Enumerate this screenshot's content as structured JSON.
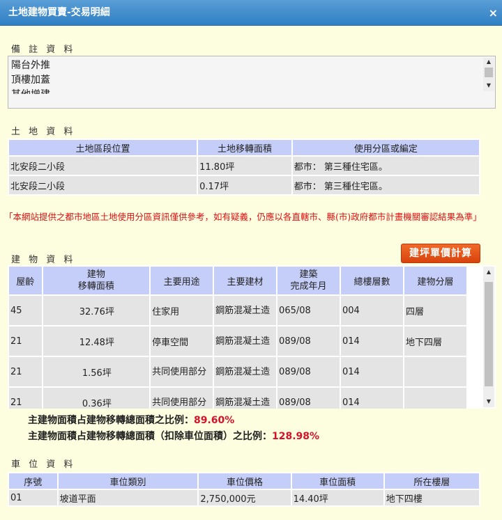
{
  "window": {
    "title": "土地建物買賣-交易明細",
    "close_icon": "×"
  },
  "notes": {
    "title": "備 註 資 料",
    "lines": [
      "陽台外推",
      "頂樓加蓋",
      "其他增建"
    ]
  },
  "land": {
    "title": "土 地 資 料",
    "headers": [
      "土地區段位置",
      "土地移轉面積",
      "使用分區或編定"
    ],
    "rows": [
      [
        "北安段二小段",
        "11.80坪",
        "都市： 第三種住宅區。"
      ],
      [
        "北安段二小段",
        "0.17坪",
        "都市： 第三種住宅區。"
      ]
    ]
  },
  "warning": "「本網站提供之都市地區土地使用分區資訊僅供參考，如有疑義，仍應以各直轄市、縣(市)政府都市計畫機關審認結果為準」",
  "building": {
    "title": "建 物 資 料",
    "calc_button": "建坪單價計算",
    "headers": [
      "屋齡",
      "建物\n移轉面積",
      "主要用途",
      "主要建材",
      "建築\n完成年月",
      "總樓層數",
      "建物分層"
    ],
    "rows": [
      [
        "45",
        "32.76坪",
        "住家用",
        "鋼筋混凝土造",
        "065/08",
        "004",
        "四層"
      ],
      [
        "21",
        "12.48坪",
        "停車空間",
        "鋼筋混凝土造",
        "089/08",
        "014",
        "地下四層"
      ],
      [
        "21",
        "1.56坪",
        "共同使用部分",
        "鋼筋混凝土造",
        "089/08",
        "014",
        ""
      ],
      [
        "21",
        "0.36坪",
        "共同使用部分",
        "鋼筋混凝土造",
        "089/08",
        "014",
        ""
      ]
    ]
  },
  "ratios": [
    {
      "label": "主建物面積占建物移轉總面積之比例：",
      "value": "89.60%"
    },
    {
      "label": "主建物面積占建物移轉總面積（扣除車位面積）之比例：",
      "value": "128.98%"
    }
  ],
  "parking": {
    "title": "車 位 資 料",
    "headers": [
      "序號",
      "車位類別",
      "車位價格",
      "車位面積",
      "所在樓層"
    ],
    "rows": [
      [
        "01",
        "坡道平面",
        "2,750,000元",
        "14.40坪",
        "地下四樓"
      ]
    ]
  },
  "colors": {
    "title_bar": "#3a88cc",
    "header_bg": "#c5cef8",
    "cell_bg": "#e4e4e4",
    "warning": "#e01010",
    "button": "#e35418",
    "ratio_value": "#d4132b",
    "page_bg": "#fdfde0"
  }
}
